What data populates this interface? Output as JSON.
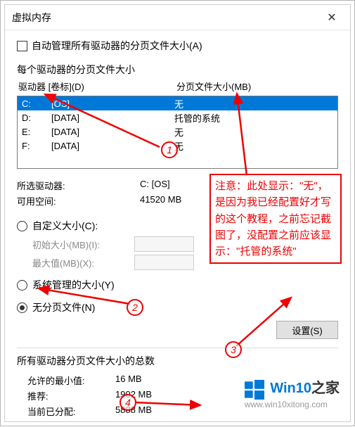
{
  "window": {
    "title": "虚拟内存",
    "close": "✕"
  },
  "automanage": {
    "label": "自动管理所有驱动器的分页文件大小(A)"
  },
  "per_drive_label": "每个驱动器的分页文件大小",
  "headers": {
    "drive": "驱动器 [卷标](D)",
    "size": "分页文件大小(MB)"
  },
  "drives": [
    {
      "letter": "C:",
      "label": "[OS]",
      "size": "无",
      "selected": true
    },
    {
      "letter": "D:",
      "label": "[DATA]",
      "size": "托管的系统",
      "selected": false
    },
    {
      "letter": "E:",
      "label": "[DATA]",
      "size": "无",
      "selected": false
    },
    {
      "letter": "F:",
      "label": "[DATA]",
      "size": "无",
      "selected": false
    }
  ],
  "selected_info": {
    "drive_label": "所选驱动器:",
    "drive_value": "C:  [OS]",
    "space_label": "可用空间:",
    "space_value": "41520 MB"
  },
  "size_options": {
    "custom": "自定义大小(C):",
    "initial": "初始大小(MB)(I):",
    "max": "最大值(MB)(X):",
    "system": "系统管理的大小(Y)",
    "none": "无分页文件(N)"
  },
  "set_button": "设置(S)",
  "totals_label": "所有驱动器分页文件大小的总数",
  "totals": {
    "min_label": "允许的最小值:",
    "min_value": "16 MB",
    "rec_label": "推荐:",
    "rec_value": "1902 MB",
    "cur_label": "当前已分配:",
    "cur_value": "5888 MB"
  },
  "markers": {
    "m1": "1",
    "m2": "2",
    "m3": "3",
    "m4": "4"
  },
  "note": "注意：此处显示：\"无\"，是因为我已经配置好才写的这个教程，之前忘记截图了，没配置之前应该显示：\"托管的系统\"",
  "watermark": {
    "text_colored": "Win10",
    "text_rest": "之家",
    "url": "www.win10xitong.com"
  }
}
